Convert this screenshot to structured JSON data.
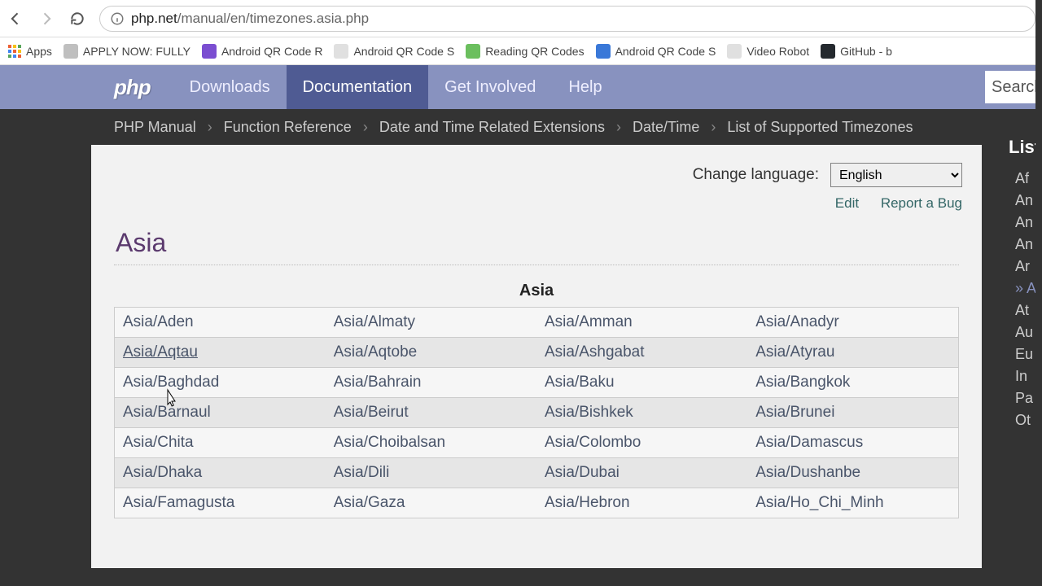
{
  "browser": {
    "url_host": "php.net",
    "url_path": "/manual/en/timezones.asia.php",
    "bookmarks": [
      {
        "label": "Apps",
        "icon": "apps"
      },
      {
        "label": "APPLY NOW: FULLY",
        "icon": "gray"
      },
      {
        "label": "Android QR Code R",
        "icon": "purple"
      },
      {
        "label": "Android QR Code S",
        "icon": "doc"
      },
      {
        "label": "Reading QR Codes",
        "icon": "green"
      },
      {
        "label": "Android QR Code S",
        "icon": "blue"
      },
      {
        "label": "Video Robot",
        "icon": "doc"
      },
      {
        "label": "GitHub - b",
        "icon": "gh"
      }
    ]
  },
  "nav": {
    "logo": "php",
    "items": [
      "Downloads",
      "Documentation",
      "Get Involved",
      "Help"
    ],
    "active": "Documentation",
    "search_placeholder": "Search"
  },
  "breadcrumbs": [
    "PHP Manual",
    "Function Reference",
    "Date and Time Related Extensions",
    "Date/Time",
    "List of Supported Timezones"
  ],
  "content": {
    "change_language_label": "Change language:",
    "language": "English",
    "edit": "Edit",
    "report": "Report a Bug",
    "title": "Asia",
    "table_caption": "Asia",
    "rows": [
      [
        "Asia/Aden",
        "Asia/Almaty",
        "Asia/Amman",
        "Asia/Anadyr"
      ],
      [
        "Asia/Aqtau",
        "Asia/Aqtobe",
        "Asia/Ashgabat",
        "Asia/Atyrau"
      ],
      [
        "Asia/Baghdad",
        "Asia/Bahrain",
        "Asia/Baku",
        "Asia/Bangkok"
      ],
      [
        "Asia/Barnaul",
        "Asia/Beirut",
        "Asia/Bishkek",
        "Asia/Brunei"
      ],
      [
        "Asia/Chita",
        "Asia/Choibalsan",
        "Asia/Colombo",
        "Asia/Damascus"
      ],
      [
        "Asia/Dhaka",
        "Asia/Dili",
        "Asia/Dubai",
        "Asia/Dushanbe"
      ],
      [
        "Asia/Famagusta",
        "Asia/Gaza",
        "Asia/Hebron",
        "Asia/Ho_Chi_Minh"
      ]
    ]
  },
  "sidebar": {
    "title": "List",
    "items": [
      "Af",
      "An",
      "An",
      "An",
      "Ar",
      "Asia",
      "At",
      "Au",
      "Eu",
      "In",
      "Pa",
      "Ot"
    ],
    "current": "Asia"
  }
}
